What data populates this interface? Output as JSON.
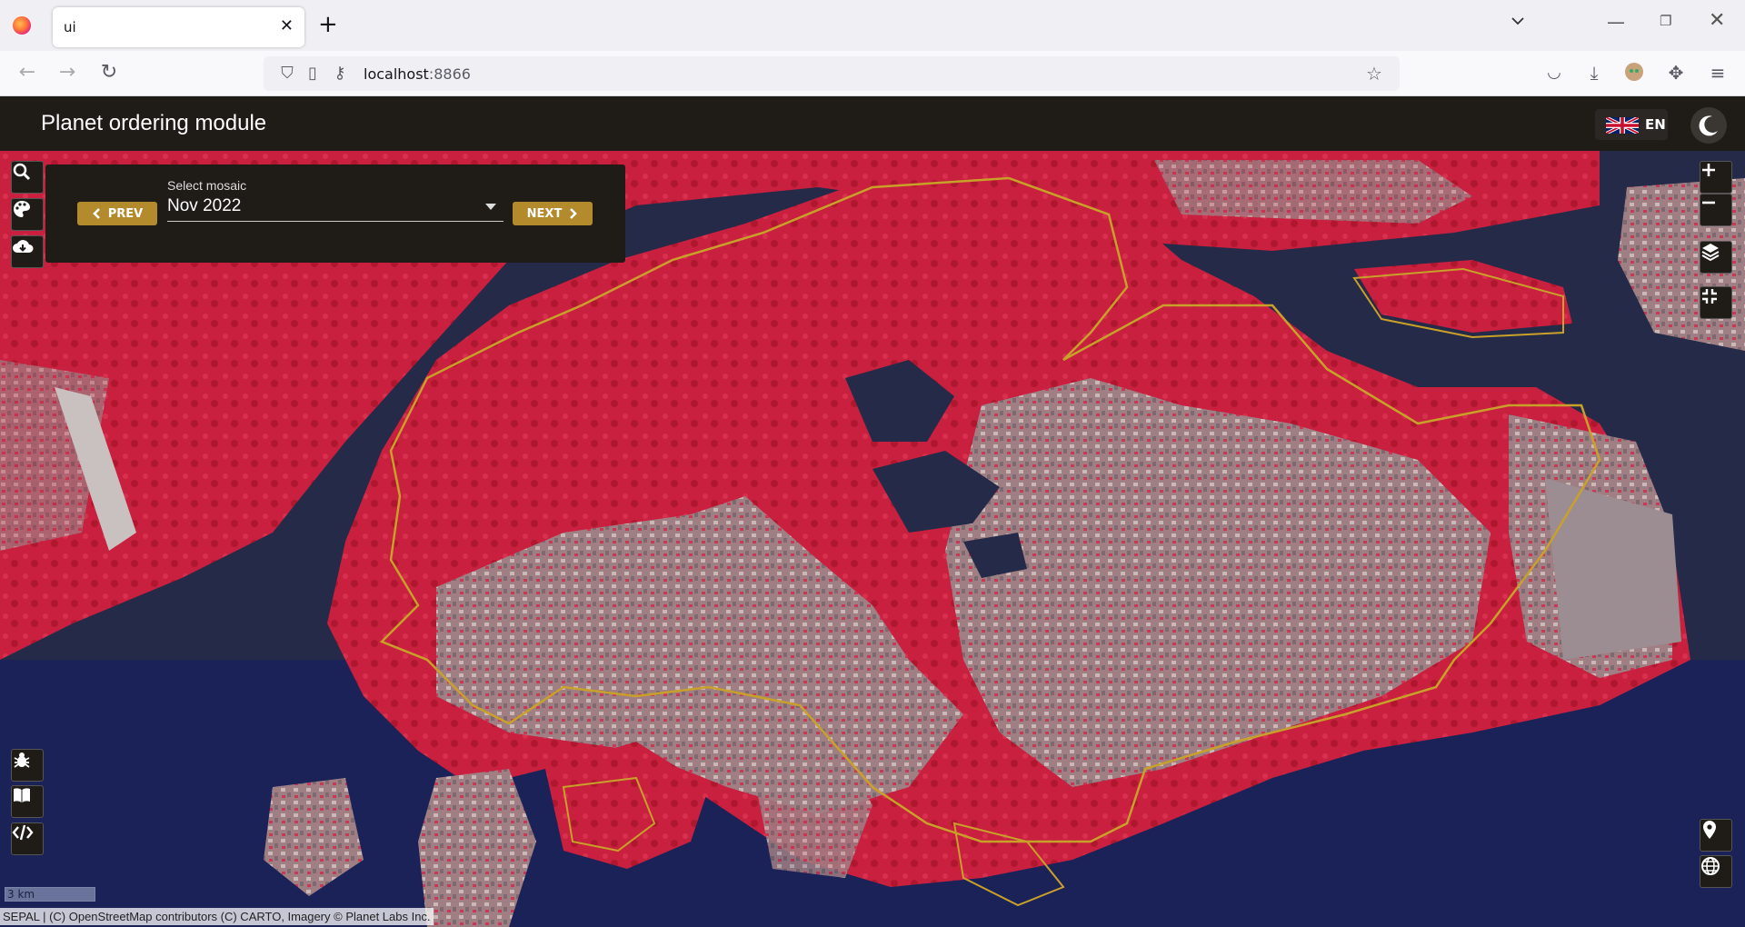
{
  "browser": {
    "tab_title": "ui",
    "url_host": "localhost",
    "url_port": ":8866"
  },
  "app": {
    "title": "Planet ordering module",
    "language": "EN"
  },
  "mosaic": {
    "label": "Select mosaic",
    "selected": "Nov 2022",
    "prev_label": "PREV",
    "next_label": "NEXT"
  },
  "map": {
    "scale_label": "3 km",
    "attribution": "SEPAL | (C) OpenStreetMap contributors (C) CARTO, Imagery © Planet Labs Inc.",
    "colors": {
      "vegetation": "#c8203e",
      "urban": "#9a7a7e",
      "water": "#1f2540",
      "boundary": "#c9a02a"
    }
  },
  "icons": {
    "left_top": [
      "search-icon",
      "palette-icon",
      "cloud-download-icon"
    ],
    "left_bottom": [
      "bug-icon",
      "book-icon",
      "code-icon"
    ],
    "right_top": [
      "zoom-in-icon",
      "zoom-out-icon",
      "layers-icon",
      "fullscreen-exit-icon"
    ],
    "right_bottom": [
      "map-marker-icon",
      "globe-icon"
    ]
  },
  "theme": {
    "accent": "#b38a2c",
    "header_bg": "#1f1c18"
  }
}
